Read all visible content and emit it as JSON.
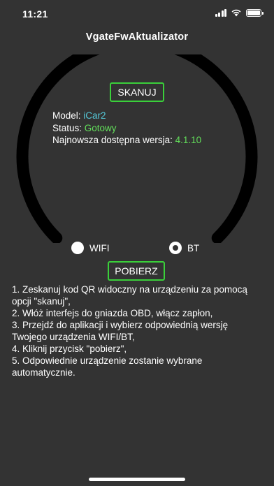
{
  "status_bar": {
    "time": "11:21"
  },
  "app": {
    "title": "VgateFwAktualizator"
  },
  "buttons": {
    "scan_label": "SKANUJ",
    "download_label": "POBIERZ"
  },
  "device": {
    "model_label": "Model: ",
    "model_value": "iCar2",
    "status_label": "Status: ",
    "status_value": "Gotowy",
    "version_label": "Najnowsza dostępna wersja: ",
    "version_value": "4.1.10"
  },
  "connection": {
    "options": [
      {
        "label": "WIFI",
        "selected": false
      },
      {
        "label": "BT",
        "selected": true
      }
    ]
  },
  "instructions": [
    "1. Zeskanuj kod QR widoczny na urządzeniu za pomocą opcji \"skanuj\",",
    "2. Włóż interfejs do gniazda OBD, włącz zapłon,",
    "3. Przejdź do aplikacji i wybierz odpowiednią wersję Twojego urządzenia WIFI/BT,",
    "4. Kliknij przycisk \"pobierz\",",
    "5. Odpowiednie urządzenie zostanie wybrane automatycznie."
  ],
  "colors": {
    "background": "#333333",
    "accent_green": "#3ad03a",
    "model_value": "#55c8d8",
    "status_value": "#63e05b"
  },
  "icons": [
    "signal-icon",
    "wifi-icon",
    "battery-icon"
  ]
}
